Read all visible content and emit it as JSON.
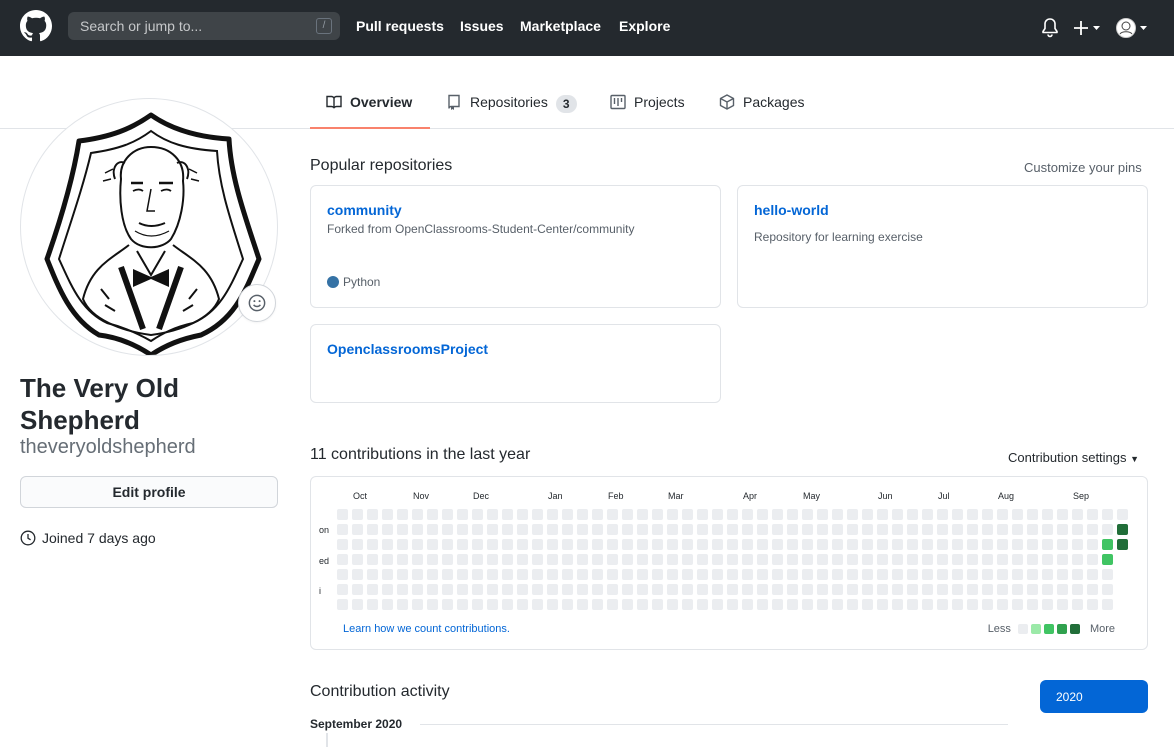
{
  "header": {
    "search_placeholder": "Search or jump to...",
    "search_shortcut": "/",
    "nav": [
      "Pull requests",
      "Issues",
      "Marketplace",
      "Explore"
    ]
  },
  "tabs": {
    "overview": "Overview",
    "repositories": "Repositories",
    "repositories_count": "3",
    "projects": "Projects",
    "packages": "Packages"
  },
  "profile": {
    "name": "The Very Old Shepherd",
    "login": "theveryoldshepherd",
    "edit_button": "Edit profile",
    "joined": "Joined 7 days ago"
  },
  "popular": {
    "title": "Popular repositories",
    "customize": "Customize your pins",
    "repos": [
      {
        "name": "community",
        "desc": "Forked from OpenClassrooms-Student-Center/community",
        "language": "Python",
        "language_color": "#3572A5"
      },
      {
        "name": "hello-world",
        "desc": "Repository for learning exercise"
      },
      {
        "name": "OpenclassroomsProject",
        "desc": ""
      }
    ]
  },
  "contributions": {
    "title": "11 contributions in the last year",
    "settings": "Contribution settings",
    "months": [
      "Oct",
      "Nov",
      "Dec",
      "Jan",
      "Feb",
      "Mar",
      "Apr",
      "May",
      "Jun",
      "Jul",
      "Aug",
      "Sep"
    ],
    "day_labels": [
      "on",
      "ed",
      "i"
    ],
    "learn_link": "Learn how we count contributions.",
    "legend_less": "Less",
    "legend_more": "More",
    "level_colors": [
      "#ebedf0",
      "#9be9a8",
      "#40c463",
      "#30a14e",
      "#216e39"
    ],
    "active_cells": [
      {
        "week": 52,
        "day": 1,
        "level": 4
      },
      {
        "week": 52,
        "day": 2,
        "level": 4
      },
      {
        "week": 51,
        "day": 2,
        "level": 2
      },
      {
        "week": 51,
        "day": 3,
        "level": 2
      }
    ],
    "active_week_count": 53,
    "last_week_days": 3
  },
  "activity": {
    "title": "Contribution activity",
    "year": "2020",
    "month": "September 2020"
  },
  "colors": {
    "header_bg": "#24292e",
    "link": "#0366d6",
    "tab_underline": "#f9826c"
  }
}
